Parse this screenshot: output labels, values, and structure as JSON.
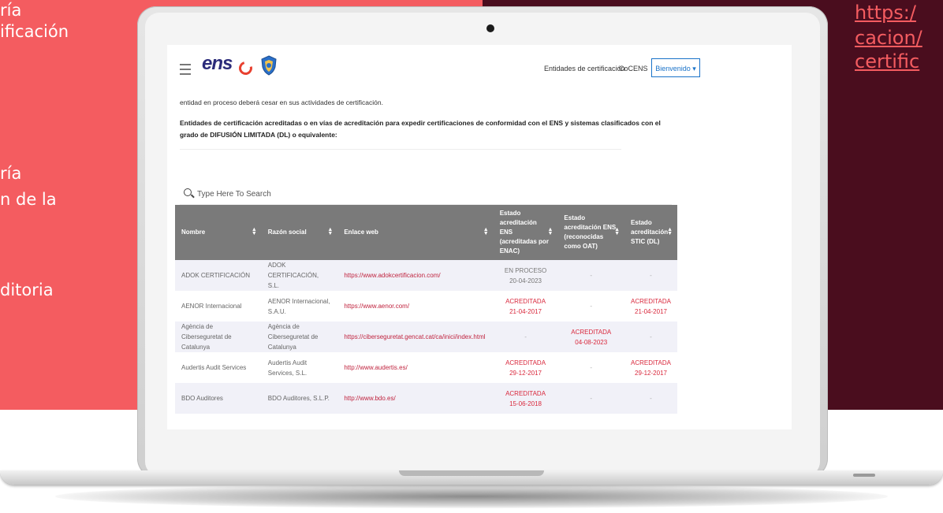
{
  "slide": {
    "left_fragments": [
      "ría",
      "ificación",
      "ría",
      "n de la",
      "ditoria"
    ],
    "right_link_lines": [
      "https:/",
      "cacion/",
      "certific"
    ],
    "colors": {
      "left_panel": "#f45c60",
      "right_panel": "#4a0d1e",
      "link": "#f45c60"
    }
  },
  "app": {
    "logo": {
      "text": "ens",
      "icon_names": [
        "ens-logo-icon",
        "shield-icon"
      ]
    },
    "nav": {
      "entidades": "Entidades de certificación",
      "cocens": "CoCENS",
      "user_menu": "Bienvenido ▾"
    }
  },
  "content": {
    "intro": "entidad en proceso deberá cesar en sus actividades de certificación.",
    "heading": "Entidades de certificación acreditadas o en vías de acreditación para expedir certificaciones de conformidad con el ENS y sistemas clasificados con el grado de DIFUSIÓN LIMITADA (DL) o equivalente:"
  },
  "search": {
    "placeholder": "Type Here To Search"
  },
  "table": {
    "headers": [
      "Nombre",
      "Razón social",
      "Enlace web",
      "Estado acreditación ENS (acreditadas por ENAC)",
      "Estado acreditación ENS (reconocidas como OAT)",
      "Estado acreditación STIC (DL)"
    ],
    "rows": [
      {
        "nombre": "ADOK CERTIFICACIÓN",
        "razon": "ADOK CERTIFICACIÓN, S.L.",
        "web": "https://www.adokcertificacion.com/",
        "enac_status": "EN PROCESO",
        "enac_date": "20-04-2023",
        "oat_status": "-",
        "oat_date": "",
        "stic_status": "-",
        "stic_date": ""
      },
      {
        "nombre": "AENOR Internacional",
        "razon": "AENOR Internacional, S.A.U.",
        "web": "https://www.aenor.com/",
        "enac_status": "ACREDITADA",
        "enac_date": "21-04-2017",
        "oat_status": "-",
        "oat_date": "",
        "stic_status": "ACREDITADA",
        "stic_date": "21-04-2017"
      },
      {
        "nombre": "Agència de Ciberseguretat de Catalunya",
        "razon": "Agència de Ciberseguretat de Catalunya",
        "web": "https://ciberseguretat.gencat.cat/ca/inici/index.html",
        "enac_status": "-",
        "enac_date": "",
        "oat_status": "ACREDITADA",
        "oat_date": "04-08-2023",
        "stic_status": "-",
        "stic_date": ""
      },
      {
        "nombre": "Audertis Audit Services",
        "razon": "Audertis Audit Services, S.L.",
        "web": "http://www.audertis.es/",
        "enac_status": "ACREDITADA",
        "enac_date": "29-12-2017",
        "oat_status": "-",
        "oat_date": "",
        "stic_status": "ACREDITADA",
        "stic_date": "29-12-2017"
      },
      {
        "nombre": "BDO Auditores",
        "razon": "BDO Auditores, S.L.P.",
        "web": "http://www.bdo.es/",
        "enac_status": "ACREDITADA",
        "enac_date": "15-06-2018",
        "oat_status": "-",
        "oat_date": "",
        "stic_status": "-",
        "stic_date": ""
      }
    ]
  }
}
